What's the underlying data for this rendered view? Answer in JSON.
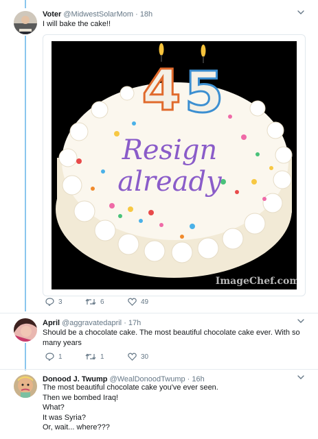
{
  "tweets": [
    {
      "name": "Voter",
      "handle": "@MidwestSolarMom",
      "time": "18h",
      "text": [
        "I will bake the cake!!"
      ],
      "media": {
        "candle_left": "4",
        "candle_right": "5",
        "line1": "Resign",
        "line2": "already",
        "watermark": "ImageChef.com"
      },
      "replies": "3",
      "retweets": "6",
      "likes": "49"
    },
    {
      "name": "April",
      "handle": "@aggravatedapril",
      "time": "17h",
      "text": [
        "Should be a chocolate cake. The most beautiful chocolate cake ever. With so",
        "many years"
      ],
      "replies": "1",
      "retweets": "1",
      "likes": "30"
    },
    {
      "name": "Donood J. Twump",
      "handle": "@WealDonoodTwump",
      "time": "16h",
      "text": [
        "The most beautiful chocolate cake you've ever seen.",
        "Then we bombed Iraq!",
        "What?",
        "It was Syria?",
        "Or, wait... where???"
      ]
    }
  ],
  "separator": "·",
  "colors": {
    "thread_line": "#8ac6ee",
    "action_gray": "#657786",
    "frosting_text": "#8a5cc9"
  }
}
